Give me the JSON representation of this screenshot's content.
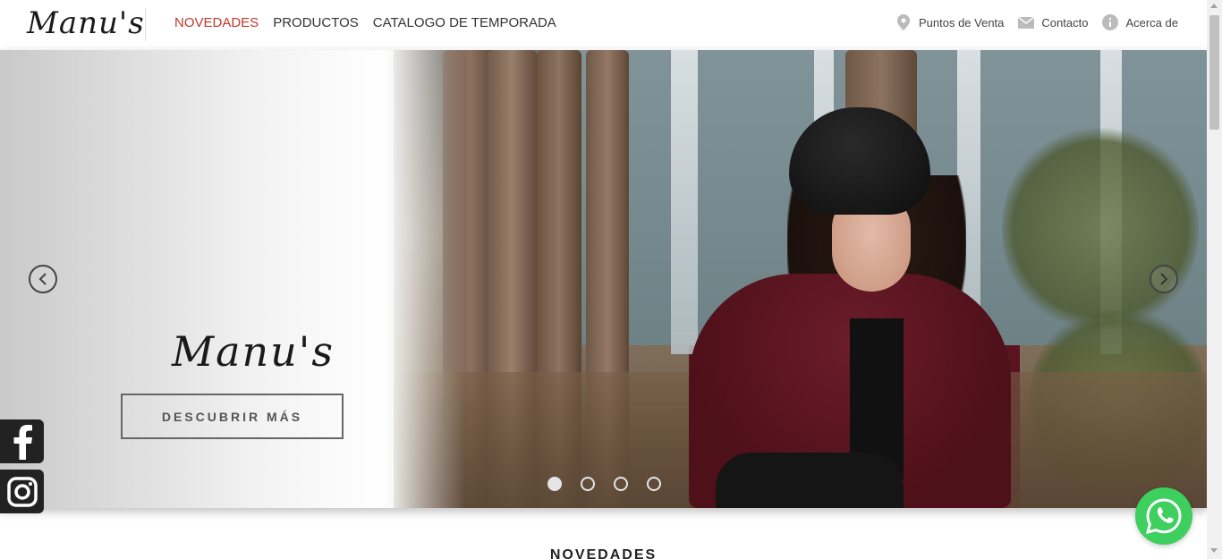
{
  "header": {
    "logo_text": "Manu's",
    "nav": [
      {
        "label": "NOVEDADES",
        "active": true
      },
      {
        "label": "PRODUCTOS",
        "active": false
      },
      {
        "label": "CATALOGO DE TEMPORADA",
        "active": false
      }
    ],
    "utility": [
      {
        "label": "Puntos de Venta",
        "icon": "map-pin-icon"
      },
      {
        "label": "Contacto",
        "icon": "envelope-icon"
      },
      {
        "label": "Acerca de",
        "icon": "info-icon"
      }
    ]
  },
  "hero": {
    "brand_text": "Manu's",
    "cta_label": "DESCUBRIR MÁS",
    "slides_count": 4,
    "active_slide": 1
  },
  "social": {
    "facebook": "facebook-icon",
    "instagram": "instagram-icon"
  },
  "whatsapp": "whatsapp-icon",
  "section": {
    "title": "NOVEDADES"
  },
  "colors": {
    "accent_red": "#c0392b",
    "whatsapp_green": "#3ecf5f"
  }
}
